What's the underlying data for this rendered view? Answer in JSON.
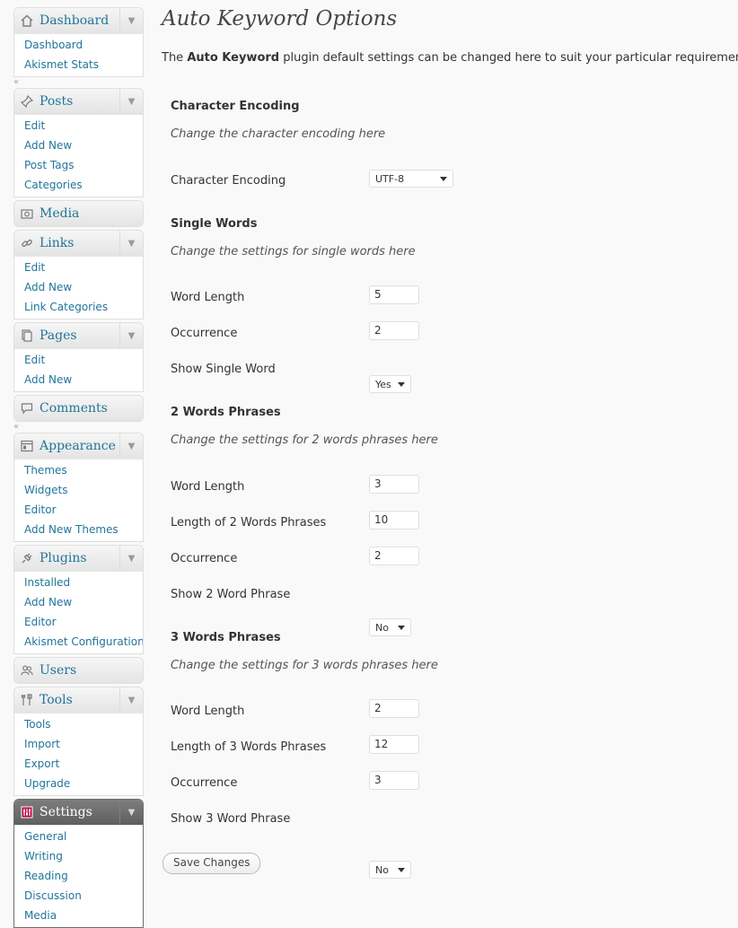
{
  "sidebar": {
    "dashboard": {
      "label": "Dashboard",
      "items": [
        "Dashboard",
        "Akismet Stats"
      ]
    },
    "posts": {
      "label": "Posts",
      "items": [
        "Edit",
        "Add New",
        "Post Tags",
        "Categories"
      ]
    },
    "media": {
      "label": "Media"
    },
    "links": {
      "label": "Links",
      "items": [
        "Edit",
        "Add New",
        "Link Categories"
      ]
    },
    "pages": {
      "label": "Pages",
      "items": [
        "Edit",
        "Add New"
      ]
    },
    "comments": {
      "label": "Comments"
    },
    "appearance": {
      "label": "Appearance",
      "items": [
        "Themes",
        "Widgets",
        "Editor",
        "Add New Themes"
      ]
    },
    "plugins": {
      "label": "Plugins",
      "items": [
        "Installed",
        "Add New",
        "Editor",
        "Akismet Configuration"
      ]
    },
    "users": {
      "label": "Users"
    },
    "tools": {
      "label": "Tools",
      "items": [
        "Tools",
        "Import",
        "Export",
        "Upgrade"
      ]
    },
    "settings": {
      "label": "Settings",
      "items": [
        "General",
        "Writing",
        "Reading",
        "Discussion",
        "Media"
      ]
    }
  },
  "page": {
    "title": "Auto Keyword Options",
    "intro_before": "The ",
    "intro_bold": "Auto Keyword",
    "intro_after": " plugin default settings can be changed here to suit your particular requirement!"
  },
  "sections": {
    "encoding": {
      "title": "Character Encoding",
      "desc": "Change the character encoding here",
      "fields": {
        "encoding_label": "Character Encoding",
        "encoding_value": "UTF-8"
      }
    },
    "single": {
      "title": "Single Words",
      "desc": "Change the settings for single words here",
      "word_length_label": "Word Length",
      "word_length_value": "5",
      "occurrence_label": "Occurrence",
      "occurrence_value": "2",
      "show_label": "Show Single Word",
      "show_value": "Yes"
    },
    "two": {
      "title": "2 Words Phrases",
      "desc": "Change the settings for 2 words phrases here",
      "word_length_label": "Word Length",
      "word_length_value": "3",
      "phrase_length_label": "Length of 2 Words Phrases",
      "phrase_length_value": "10",
      "occurrence_label": "Occurrence",
      "occurrence_value": "2",
      "show_label": "Show 2 Word Phrase",
      "show_value": "No"
    },
    "three": {
      "title": "3 Words Phrases",
      "desc": "Change the settings for 3 words phrases here",
      "word_length_label": "Word Length",
      "word_length_value": "2",
      "phrase_length_label": "Length of 3 Words Phrases",
      "phrase_length_value": "12",
      "occurrence_label": "Occurrence",
      "occurrence_value": "3",
      "show_label": "Show 3 Word Phrase",
      "show_value": "No"
    }
  },
  "save_label": "Save Changes",
  "colors": {
    "link": "#21759b",
    "current_menu": "#6d6d6d",
    "background": "#f9f9f9"
  }
}
